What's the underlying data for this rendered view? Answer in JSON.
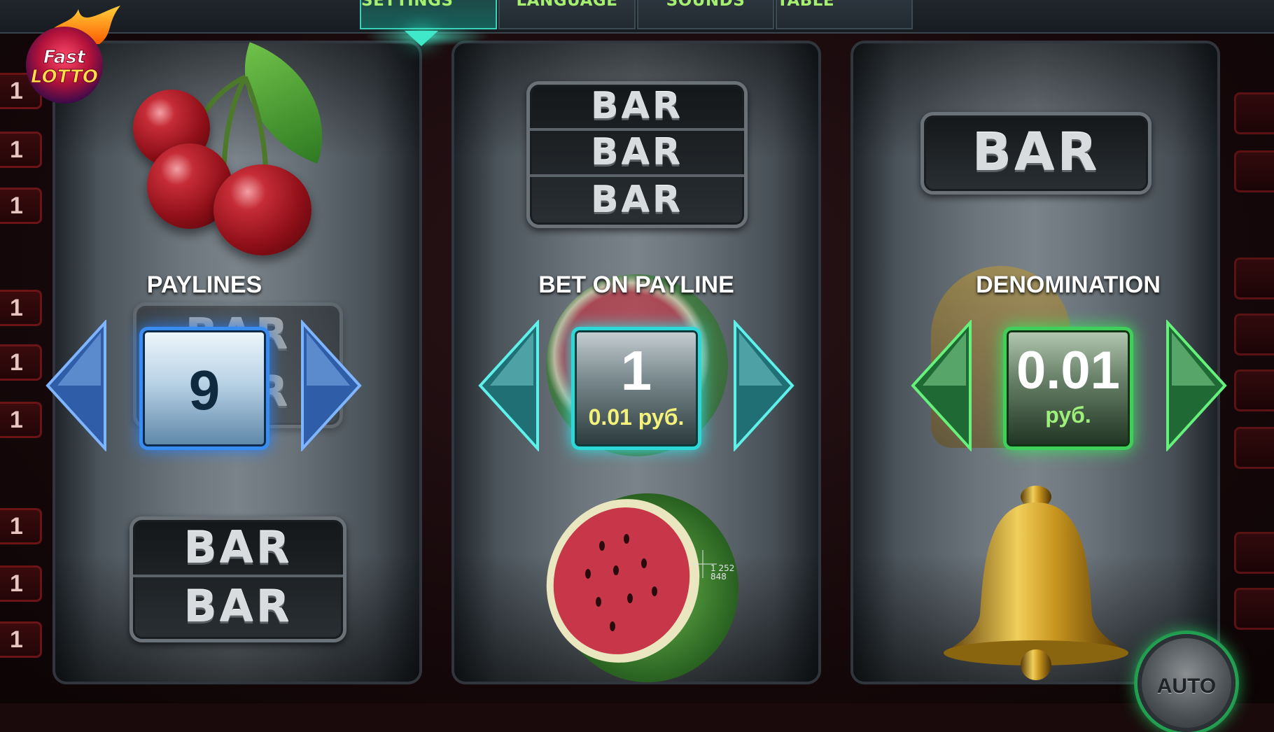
{
  "logo": {
    "line1": "Fast",
    "line2": "LOTTO"
  },
  "tabs": [
    {
      "label": "GAME SETTINGS",
      "active": true
    },
    {
      "label": "LANGUAGE",
      "active": false
    },
    {
      "label": "SOUNDS",
      "active": false
    },
    {
      "label": "PAYOUT TABLE",
      "active": false
    }
  ],
  "line_indicators": [
    "1",
    "1",
    "1",
    "1",
    "1",
    "1",
    "1",
    "1",
    "1"
  ],
  "symbols": {
    "bar": "BAR"
  },
  "paylines": {
    "title": "PAYLINES",
    "value": "9"
  },
  "bet": {
    "title": "BET ON PAYLINE",
    "value": "1",
    "sub": "0.01 руб."
  },
  "denomination": {
    "title": "DENOMINATION",
    "value": "0.01",
    "sub": "руб."
  },
  "auto_button": {
    "label": "AUTO"
  },
  "cursor_readout": {
    "line1": "1 252",
    "line2": "848"
  },
  "colors": {
    "tab_text": "#a6f070",
    "paylines_accent": "#3a8df0",
    "bet_accent": "#2fd8d8",
    "denomination_accent": "#3fcf5a",
    "bet_sub_text": "#f4f27a",
    "denomination_sub_text": "#9df07a"
  }
}
